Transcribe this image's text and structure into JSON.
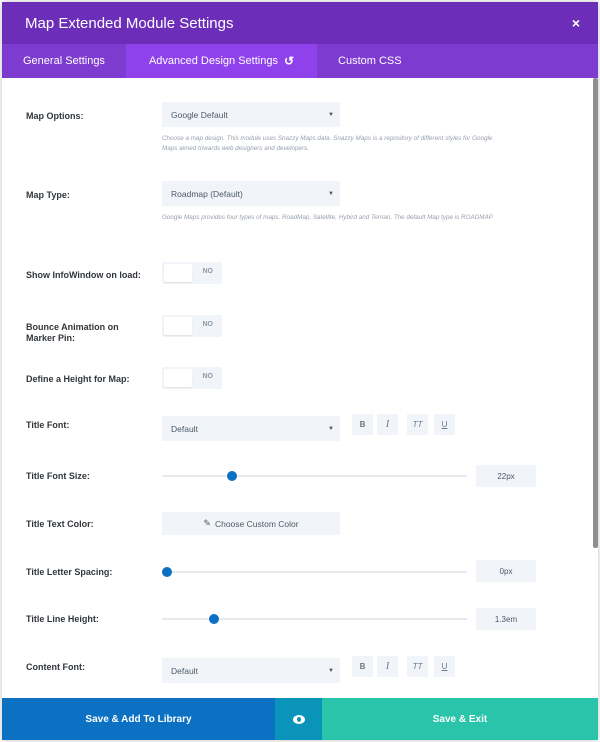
{
  "header": {
    "title": "Map Extended Module Settings",
    "close_glyph": "×"
  },
  "tabs": [
    {
      "label": "General Settings"
    },
    {
      "label": "Advanced Design Settings",
      "icon": "undo-icon",
      "glyph": "↺"
    },
    {
      "label": "Custom CSS"
    }
  ],
  "fields": {
    "map_options": {
      "label": "Map Options:",
      "value": "Google Default",
      "description": "Choose a map design. This module uses Snazzy Maps data. Snazzy Maps is a repository of different styles for Google Maps aimed towards web designers and developers."
    },
    "map_type": {
      "label": "Map Type:",
      "value": "Roadmap (Default)",
      "description": "Google Maps provides four types of maps. RoadMap, Satellite, Hybird and Terrian. The default Map type is ROADMAP"
    },
    "show_infowindow": {
      "label": "Show InfoWindow on load:",
      "state": "NO"
    },
    "bounce_animation": {
      "label": "Bounce Animation on Marker Pin:",
      "state": "NO"
    },
    "define_height": {
      "label": "Define a Height for Map:",
      "state": "NO"
    },
    "title_font": {
      "label": "Title Font:",
      "value": "Default"
    },
    "title_font_size": {
      "label": "Title Font Size:",
      "value": "22px",
      "slider_fraction": 0.22
    },
    "title_text_color": {
      "label": "Title Text Color:",
      "button": "Choose Custom Color"
    },
    "title_letter_spacing": {
      "label": "Title Letter Spacing:",
      "value": "0px",
      "slider_fraction": 0.0
    },
    "title_line_height": {
      "label": "Title Line Height:",
      "value": "1.3em",
      "slider_fraction": 0.16
    },
    "content_font": {
      "label": "Content Font:",
      "value": "Default"
    }
  },
  "format_buttons": [
    "B",
    "I",
    "TT",
    "U"
  ],
  "footer": {
    "save_library": "Save & Add To Library",
    "save_exit": "Save & Exit"
  },
  "colors": {
    "header": "#6c2eb9",
    "tabs": "#7e3bd0",
    "active_tab": "#8f42ec",
    "accent_blue": "#0c71c3",
    "preview": "#0b94ba",
    "save_green": "#29c4a9"
  }
}
